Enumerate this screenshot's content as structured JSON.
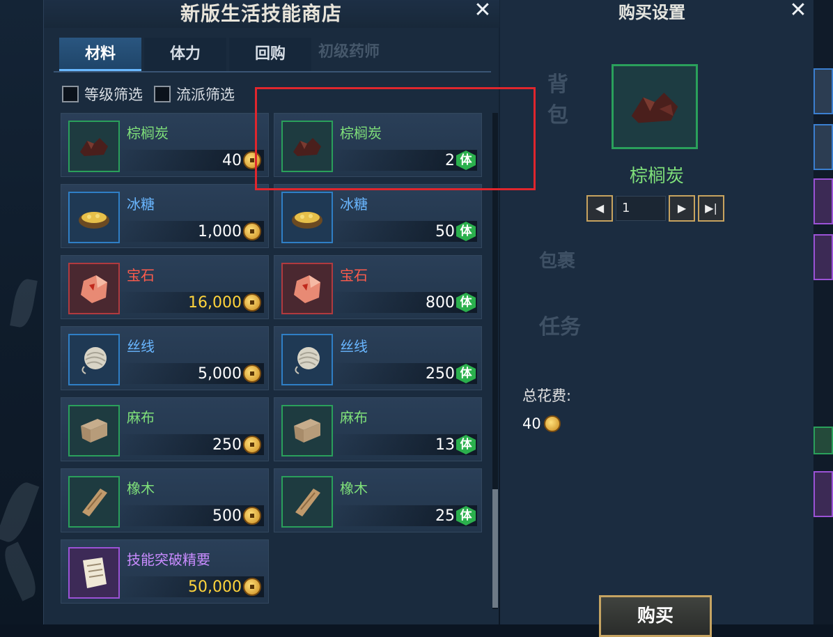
{
  "shop": {
    "title": "新版生活技能商店",
    "close_label": "✕",
    "tabs": [
      {
        "label": "材料",
        "active": true
      },
      {
        "label": "体力",
        "active": false
      },
      {
        "label": "回购",
        "active": false
      }
    ],
    "filters": [
      {
        "label": "等级筛选",
        "checked": false
      },
      {
        "label": "流派筛选",
        "checked": false
      }
    ],
    "items_coin": [
      {
        "name": "棕榈炭",
        "price": "40",
        "rarity": "green",
        "price_color": "white"
      },
      {
        "name": "冰糖",
        "price": "1,000",
        "rarity": "blue",
        "price_color": "white"
      },
      {
        "name": "宝石",
        "price": "16,000",
        "rarity": "red",
        "price_color": "gold"
      },
      {
        "name": "丝线",
        "price": "5,000",
        "rarity": "blue",
        "price_color": "white"
      },
      {
        "name": "麻布",
        "price": "250",
        "rarity": "green",
        "price_color": "white"
      },
      {
        "name": "橡木",
        "price": "500",
        "rarity": "green",
        "price_color": "white"
      },
      {
        "name": "技能突破精要",
        "price": "50,000",
        "rarity": "purple",
        "price_color": "gold"
      }
    ],
    "items_stamina": [
      {
        "name": "棕榈炭",
        "price": "2",
        "rarity": "green"
      },
      {
        "name": "冰糖",
        "price": "50",
        "rarity": "blue"
      },
      {
        "name": "宝石",
        "price": "800",
        "rarity": "red"
      },
      {
        "name": "丝线",
        "price": "250",
        "rarity": "blue"
      },
      {
        "name": "麻布",
        "price": "13",
        "rarity": "green"
      },
      {
        "name": "橡木",
        "price": "25",
        "rarity": "green"
      }
    ],
    "stamina_glyph": "体",
    "scroll_position": 0.76
  },
  "buy_panel": {
    "title": "购买设置",
    "close_label": "✕",
    "item_name": "棕榈炭",
    "quantity": "1",
    "total_label": "总花费:",
    "total_value": "40",
    "buy_button": "购买",
    "bg_labels": [
      "背",
      "包",
      "包裹",
      "任务",
      "初级药师"
    ]
  },
  "colors": {
    "green": "#7fe07a",
    "blue": "#69b6ff",
    "red": "#ff5c4c",
    "purple": "#c98cff",
    "gold": "#ffd43c",
    "highlight": "#e0262d"
  },
  "icons": {
    "charcoal": "charcoal-icon",
    "rock_sugar": "rock-sugar-icon",
    "gem": "gem-icon",
    "silk": "silk-thread-icon",
    "linen": "linen-cloth-icon",
    "oak": "oak-wood-icon",
    "scroll": "skill-scroll-icon"
  }
}
